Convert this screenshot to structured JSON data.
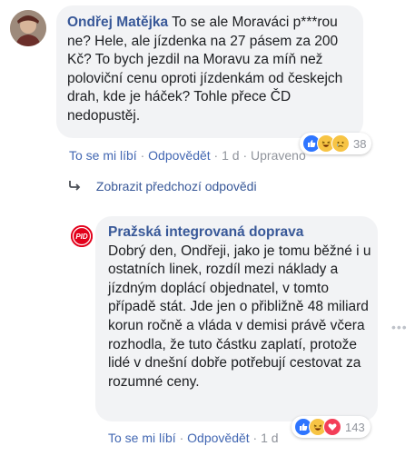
{
  "comment1": {
    "author": "Ondřej Matějka",
    "text": " To se ale Moraváci p***rou ne? Hele, ale jízdenka na 27 pásem za 200 Kč? To bych jezdil na Moravu za míň než poloviční cenu oproti jízdenkám od českejch drah, kde je háček? Tohle přece ČD nedopustěj.",
    "actions": {
      "like": "To se mi líbí",
      "reply": "Odpovědět",
      "time": "1 d",
      "edited": "Upraveno"
    },
    "reactions": {
      "count": "38",
      "icons": [
        "like-icon",
        "haha-icon",
        "sad-icon"
      ]
    }
  },
  "replies_link": {
    "label": "Zobrazit předchozí odpovědi"
  },
  "comment2": {
    "author": "Pražská integrovaná doprava",
    "text": "Dobrý den, Ondřeji, jako je tomu běžné i u ostatních linek, rozdíl mezi náklady a jízdným doplácí objednatel, v tomto případě stát. Jde jen o přibližně 48 miliard korun ročně a vláda v demisi právě včera rozhodla, že tuto částku zaplatí, protože lidé v dnešní dobře potřebují cestovat za rozumné ceny.",
    "actions": {
      "like": "To se mi líbí",
      "reply": "Odpovědět",
      "time": "1 d"
    },
    "reactions": {
      "count": "143",
      "icons": [
        "like-icon",
        "haha-icon",
        "love-icon"
      ]
    },
    "logo_text": "PID"
  },
  "colors": {
    "link": "#385898",
    "action": "#4267b2",
    "bubble": "#f2f3f5",
    "brand_red": "#e3001b"
  }
}
